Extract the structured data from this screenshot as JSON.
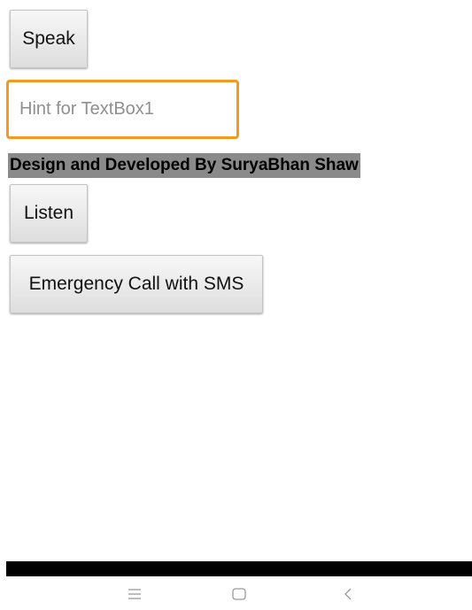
{
  "buttons": {
    "speak": "Speak",
    "listen": "Listen",
    "emergency": "Emergency Call with SMS"
  },
  "textbox": {
    "placeholder": "Hint for TextBox1",
    "value": "",
    "focus_border_color": "#f29b1f"
  },
  "credit_label": {
    "text": "Design and Developed By SuryaBhan Shaw",
    "background_color": "#8a8a8a"
  },
  "navigation": {
    "icons": [
      "menu-icon",
      "home-icon",
      "back-icon"
    ]
  }
}
